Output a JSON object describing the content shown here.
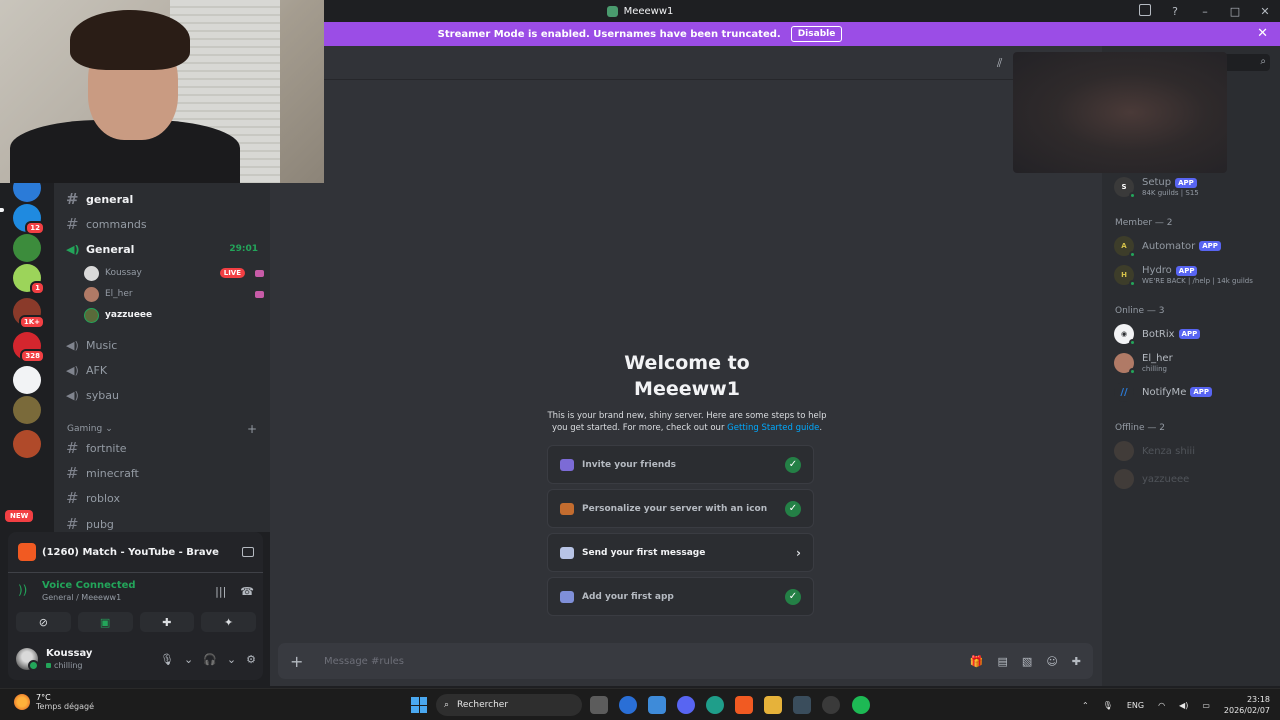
{
  "window": {
    "title": "Meeeww1"
  },
  "banner": {
    "text": "Streamer Mode is enabled. Usernames have been truncated.",
    "disable_label": "Disable"
  },
  "rail": {
    "servers": [
      {
        "color": "#2b7bd8",
        "badge": ""
      },
      {
        "color": "#1f8ae0",
        "badge": "12"
      },
      {
        "color": "#3c8c3c",
        "badge": ""
      },
      {
        "color": "#9cd45a",
        "badge": "1"
      },
      {
        "color": "#8a3a2a",
        "badge": "1K+"
      },
      {
        "color": "#d4262e",
        "badge": "328"
      },
      {
        "color": "#f2f3f5",
        "badge": ""
      },
      {
        "color": "#7a6a3a",
        "badge": ""
      },
      {
        "color": "#b04a2a",
        "badge": ""
      }
    ],
    "new_label": "NEW"
  },
  "channels": {
    "general": "general",
    "commands": "commands",
    "voice_general": "General",
    "voice_timer": "29:01",
    "voice_users": [
      {
        "name": "Koussay",
        "live": "LIVE"
      },
      {
        "name": "El_her"
      },
      {
        "name": "yazzueee"
      }
    ],
    "music": "Music",
    "afk": "AFK",
    "sybau": "sybau",
    "category_gaming": "Gaming",
    "fortnite": "fortnite",
    "minecraft": "minecraft",
    "roblox": "roblox",
    "pubg": "pubg"
  },
  "panel": {
    "stream_title": "(1260) Match - YouTube - Brave",
    "voice_status": "Voice Connected",
    "voice_location": "General / Meeeww1",
    "username": "Koussay",
    "user_status": "chilling"
  },
  "welcome": {
    "title_line1": "Welcome to",
    "title_line2": "Meeeww1",
    "desc": "This is your brand new, shiny server. Here are some steps to help you get started. For more, check out our",
    "link": "Getting Started guide",
    "link_end": "."
  },
  "tasks": [
    {
      "label": "Invite your friends",
      "done": true
    },
    {
      "label": "Personalize your server with an icon",
      "done": true
    },
    {
      "label": "Send your first message",
      "done": false
    },
    {
      "label": "Add your first app",
      "done": true
    }
  ],
  "composer": {
    "placeholder": "Message #rules"
  },
  "members": {
    "setup": {
      "name": "Setup",
      "tag": "APP",
      "sub": "84K guilds | S15"
    },
    "member_heading": "Member — 2",
    "automator": {
      "name": "Automator",
      "tag": "APP"
    },
    "hydro": {
      "name": "Hydro",
      "tag": "APP",
      "sub": "WE'RE BACK | /help | 14k guilds"
    },
    "online_heading": "Online — 3",
    "botrix": {
      "name": "BotRix",
      "tag": "APP"
    },
    "elher": {
      "name": "El_her",
      "sub": "chilling"
    },
    "notifyme": {
      "name": "NotifyMe",
      "tag": "APP"
    },
    "offline_heading": "Offline — 2",
    "kenza": {
      "name": "Kenza shiii"
    },
    "yazzueee": {
      "name": "yazzueee"
    }
  },
  "taskbar": {
    "temp": "7°C",
    "weather": "Temps dégagé",
    "search": "Rechercher",
    "lang": "ENG",
    "time": "23:18",
    "date": "2026/02/07"
  }
}
